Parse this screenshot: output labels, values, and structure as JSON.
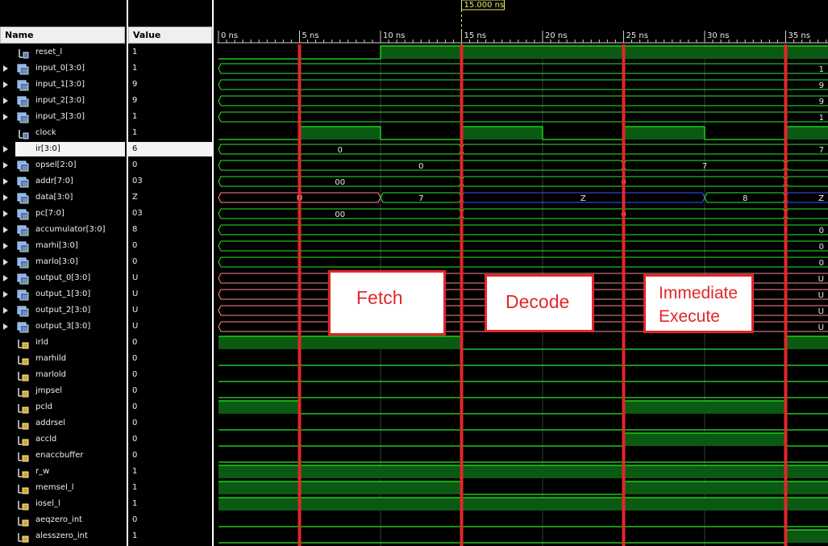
{
  "columns": {
    "name": "Name",
    "value": "Value"
  },
  "cursor": {
    "time_label": "15.000 ns",
    "time_ns": 15
  },
  "timeline": {
    "ticks": [
      "0 ns",
      "5 ns",
      "10 ns",
      "15 ns",
      "20 ns",
      "25 ns",
      "30 ns",
      "35 ns"
    ]
  },
  "phases": [
    {
      "label": "Fetch"
    },
    {
      "label": "Decode"
    },
    {
      "label": "Immediate\nExecute"
    }
  ],
  "signals": [
    {
      "name": "reset_l",
      "value": "1",
      "bus": false,
      "expand": false
    },
    {
      "name": "input_0[3:0]",
      "value": "1",
      "bus": true,
      "expand": true
    },
    {
      "name": "input_1[3:0]",
      "value": "9",
      "bus": true,
      "expand": true
    },
    {
      "name": "input_2[3:0]",
      "value": "9",
      "bus": true,
      "expand": true
    },
    {
      "name": "input_3[3:0]",
      "value": "1",
      "bus": true,
      "expand": true
    },
    {
      "name": "clock",
      "value": "1",
      "bus": false,
      "expand": false
    },
    {
      "name": "ir[3:0]",
      "value": "6",
      "bus": true,
      "expand": true,
      "selected": true
    },
    {
      "name": "opsel[2:0]",
      "value": "0",
      "bus": true,
      "expand": true
    },
    {
      "name": "addr[7:0]",
      "value": "03",
      "bus": true,
      "expand": true
    },
    {
      "name": "data[3:0]",
      "value": "Z",
      "bus": true,
      "expand": true
    },
    {
      "name": "pc[7:0]",
      "value": "03",
      "bus": true,
      "expand": true
    },
    {
      "name": "accumulator[3:0]",
      "value": "8",
      "bus": true,
      "expand": true
    },
    {
      "name": "marhi[3:0]",
      "value": "0",
      "bus": true,
      "expand": true
    },
    {
      "name": "marlo[3:0]",
      "value": "0",
      "bus": true,
      "expand": true
    },
    {
      "name": "output_0[3:0]",
      "value": "U",
      "bus": true,
      "expand": true
    },
    {
      "name": "output_1[3:0]",
      "value": "U",
      "bus": true,
      "expand": true
    },
    {
      "name": "output_2[3:0]",
      "value": "U",
      "bus": true,
      "expand": true
    },
    {
      "name": "output_3[3:0]",
      "value": "U",
      "bus": true,
      "expand": true
    },
    {
      "name": "irld",
      "value": "0",
      "bus": false,
      "expand": false,
      "ctl": true
    },
    {
      "name": "marhild",
      "value": "0",
      "bus": false,
      "expand": false,
      "ctl": true
    },
    {
      "name": "marlold",
      "value": "0",
      "bus": false,
      "expand": false,
      "ctl": true
    },
    {
      "name": "jmpsel",
      "value": "0",
      "bus": false,
      "expand": false,
      "ctl": true
    },
    {
      "name": "pcld",
      "value": "0",
      "bus": false,
      "expand": false,
      "ctl": true
    },
    {
      "name": "addrsel",
      "value": "0",
      "bus": false,
      "expand": false,
      "ctl": true
    },
    {
      "name": "accld",
      "value": "0",
      "bus": false,
      "expand": false,
      "ctl": true
    },
    {
      "name": "enaccbuffer",
      "value": "0",
      "bus": false,
      "expand": false,
      "ctl": true
    },
    {
      "name": "r_w",
      "value": "1",
      "bus": false,
      "expand": false,
      "ctl": true
    },
    {
      "name": "memsel_l",
      "value": "1",
      "bus": false,
      "expand": false,
      "ctl": true
    },
    {
      "name": "iosel_l",
      "value": "1",
      "bus": false,
      "expand": false,
      "ctl": true
    },
    {
      "name": "aeqzero_int",
      "value": "0",
      "bus": false,
      "expand": false,
      "ctl": true
    },
    {
      "name": "alesszero_int",
      "value": "1",
      "bus": false,
      "expand": false,
      "ctl": true
    }
  ],
  "waves": [
    {
      "type": "bit",
      "levels": [
        [
          0,
          0
        ],
        [
          10,
          1
        ]
      ]
    },
    {
      "type": "bus",
      "segs": [
        [
          0,
          38,
          "1",
          "g"
        ]
      ]
    },
    {
      "type": "bus",
      "segs": [
        [
          0,
          38,
          "9",
          "g"
        ]
      ]
    },
    {
      "type": "bus",
      "segs": [
        [
          0,
          38,
          "9",
          "g"
        ]
      ]
    },
    {
      "type": "bus",
      "segs": [
        [
          0,
          38,
          "1",
          "g"
        ]
      ]
    },
    {
      "type": "bit",
      "levels": [
        [
          0,
          0
        ],
        [
          5,
          1
        ],
        [
          10,
          0
        ],
        [
          15,
          1
        ],
        [
          20,
          0
        ],
        [
          25,
          1
        ],
        [
          30,
          0
        ],
        [
          35,
          1
        ]
      ]
    },
    {
      "type": "bus",
      "segs": [
        [
          0,
          15,
          "0",
          "g"
        ],
        [
          15,
          38,
          "7",
          "g"
        ]
      ]
    },
    {
      "type": "bus",
      "segs": [
        [
          0,
          25,
          "0",
          "g"
        ],
        [
          25,
          35,
          "7",
          "g"
        ],
        [
          35,
          38,
          "",
          "g"
        ]
      ]
    },
    {
      "type": "bus",
      "segs": [
        [
          0,
          15,
          "00",
          "g"
        ],
        [
          15,
          35,
          "0",
          "g"
        ],
        [
          35,
          38,
          "",
          "g"
        ]
      ]
    },
    {
      "type": "bus",
      "segs": [
        [
          0,
          10,
          "U",
          "r"
        ],
        [
          10,
          15,
          "7",
          "g"
        ],
        [
          15,
          30,
          "Z",
          "b"
        ],
        [
          30,
          35,
          "8",
          "g"
        ],
        [
          35,
          38,
          "Z",
          "b"
        ]
      ]
    },
    {
      "type": "bus",
      "segs": [
        [
          0,
          15,
          "00",
          "g"
        ],
        [
          15,
          35,
          "0",
          "g"
        ],
        [
          35,
          38,
          "",
          "g"
        ]
      ]
    },
    {
      "type": "bus",
      "segs": [
        [
          0,
          38,
          "0",
          "g"
        ]
      ]
    },
    {
      "type": "bus",
      "segs": [
        [
          0,
          38,
          "0",
          "g"
        ]
      ]
    },
    {
      "type": "bus",
      "segs": [
        [
          0,
          38,
          "0",
          "g"
        ]
      ]
    },
    {
      "type": "bus",
      "segs": [
        [
          0,
          38,
          "U",
          "r"
        ]
      ]
    },
    {
      "type": "bus",
      "segs": [
        [
          0,
          38,
          "U",
          "r"
        ]
      ]
    },
    {
      "type": "bus",
      "segs": [
        [
          0,
          38,
          "U",
          "r"
        ]
      ]
    },
    {
      "type": "bus",
      "segs": [
        [
          0,
          38,
          "U",
          "r"
        ]
      ]
    },
    {
      "type": "bit",
      "levels": [
        [
          0,
          1
        ],
        [
          15,
          0
        ],
        [
          35,
          1
        ]
      ]
    },
    {
      "type": "bit",
      "levels": [
        [
          0,
          0
        ]
      ]
    },
    {
      "type": "bit",
      "levels": [
        [
          0,
          0
        ]
      ]
    },
    {
      "type": "bit",
      "levels": [
        [
          0,
          0
        ]
      ]
    },
    {
      "type": "bit",
      "levels": [
        [
          0,
          1
        ],
        [
          5,
          0
        ],
        [
          25,
          1
        ],
        [
          35,
          0
        ]
      ]
    },
    {
      "type": "bit",
      "levels": [
        [
          0,
          0
        ]
      ]
    },
    {
      "type": "bit",
      "levels": [
        [
          0,
          0
        ],
        [
          25,
          1
        ],
        [
          35,
          0
        ]
      ]
    },
    {
      "type": "bit",
      "levels": [
        [
          0,
          0
        ]
      ]
    },
    {
      "type": "bit",
      "levels": [
        [
          0,
          1
        ]
      ]
    },
    {
      "type": "bit",
      "levels": [
        [
          0,
          1
        ],
        [
          15,
          0
        ],
        [
          25,
          1
        ]
      ]
    },
    {
      "type": "bit",
      "levels": [
        [
          0,
          1
        ]
      ]
    },
    {
      "type": "bit",
      "levels": [
        [
          0,
          0
        ]
      ]
    },
    {
      "type": "bit",
      "levels": [
        [
          0,
          0
        ],
        [
          35,
          1
        ]
      ]
    }
  ],
  "phase_markers_ns": [
    5,
    15,
    25,
    35
  ],
  "colors": {
    "wave_green": "#22ee22",
    "wave_fill": "#0b5a12",
    "wave_red": "#ff8888",
    "wave_blue": "#3355ff",
    "marker_red": "#e3262a",
    "cursor": "#e8e870"
  }
}
